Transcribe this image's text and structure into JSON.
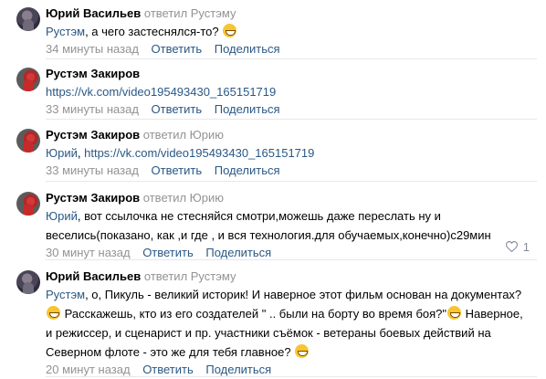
{
  "comments": [
    {
      "author": "Юрий Васильев",
      "reply_to": "ответил Рустэму",
      "mention": "Рустэм",
      "text": ", а чего застеснялся-то?",
      "time": "34 минуты назад",
      "reply_label": "Ответить",
      "share_label": "Поделиться"
    },
    {
      "author": "Рустэм Закиров",
      "link": "https://vk.com/video195493430_165151719",
      "time": "33 минуты назад",
      "reply_label": "Ответить",
      "share_label": "Поделиться"
    },
    {
      "author": "Рустэм Закиров",
      "reply_to": "ответил Юрию",
      "mention": "Юрий",
      "separator": ", ",
      "link": "https://vk.com/video195493430_165151719",
      "time": "33 минуты назад",
      "reply_label": "Ответить",
      "share_label": "Поделиться"
    },
    {
      "author": "Рустэм Закиров",
      "reply_to": "ответил Юрию",
      "mention": "Юрий",
      "text_line1": ", вот ссылочка не стесняйся смотри,можешь даже переслать ну и",
      "text_line2": "веселись(показано, как ,и где , и вся технология.для обучаемых,конечно)с29мин",
      "time": "30 минут назад",
      "reply_label": "Ответить",
      "share_label": "Поделиться",
      "likes": "1"
    },
    {
      "author": "Юрий Васильев",
      "reply_to": "ответил Рустэму",
      "mention": "Рустэм",
      "text_line1": ", о, Пикуль - великий историк! И наверное этот фильм основан на документах?",
      "text_line2": "Расскажешь, кто из его создателей \" .. были на борту во время боя?\"",
      "text_line2b": " Наверное,",
      "text_line3": "и режиссер, и сценарист и пр. участники съёмок - ветераны боевых действий на",
      "text_line4": "Северном флоте - это же для тебя главное?",
      "time": "20 минут назад",
      "reply_label": "Ответить",
      "share_label": "Поделиться"
    }
  ],
  "icons": {
    "avatar": "user-avatar",
    "emoji": "grinning-emoji",
    "like": "heart-icon"
  },
  "colors": {
    "link": "#2a5885",
    "meta": "#939393",
    "divider": "#e7e8ec"
  }
}
